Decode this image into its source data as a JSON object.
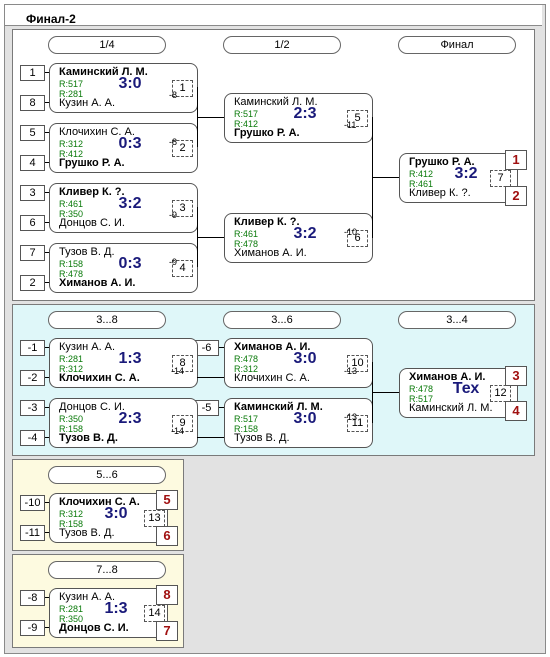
{
  "title": "Финал-2",
  "stages": {
    "q": "1/4",
    "s": "1/2",
    "f": "Финал",
    "r38": "3...8",
    "r36": "3...6",
    "r34": "3...4",
    "r56": "5...6",
    "r78": "7...8"
  },
  "seeds": {
    "s1": "1",
    "s8": "8",
    "s5": "5",
    "s4": "4",
    "s3": "3",
    "s6": "6",
    "s7": "7",
    "s2": "2",
    "m1": "-1",
    "m2": "-2",
    "m3": "-3",
    "m4": "-4",
    "m6": "-6",
    "m5": "-5",
    "m10": "-10",
    "m11": "-11",
    "m8": "-8",
    "m9": "-9"
  },
  "matches": {
    "m1": {
      "p1": "Каминский Л. М.",
      "r1": "R:517",
      "r2": "R:281",
      "p2": "Кузин А. А.",
      "score": "3:0",
      "num": "1",
      "out": "-8"
    },
    "m2": {
      "p1": "Клочихин С. А.",
      "r1": "R:312",
      "r2": "R:412",
      "p2": "Грушко Р. А.",
      "score": "0:3",
      "num": "2",
      "out": "-8"
    },
    "m3": {
      "p1": "Кливер К. ?.",
      "r1": "R:461",
      "r2": "R:350",
      "p2": "Донцов С. И.",
      "score": "3:2",
      "num": "3",
      "out": "-9"
    },
    "m4": {
      "p1": "Тузов В. Д.",
      "r1": "R:158",
      "r2": "R:478",
      "p2": "Химанов А. И.",
      "score": "0:3",
      "num": "4",
      "out": "-9"
    },
    "m5": {
      "p1": "Каминский Л. М.",
      "r1": "R:517",
      "r2": "R:412",
      "p2": "Грушко Р. А.",
      "score": "2:3",
      "num": "5",
      "out": "-11"
    },
    "m6": {
      "p1": "Кливер К. ?.",
      "r1": "R:461",
      "r2": "R:478",
      "p2": "Химанов А. И.",
      "score": "3:2",
      "num": "6",
      "out": "-10"
    },
    "m7": {
      "p1": "Грушко Р. А.",
      "r1": "R:412",
      "r2": "R:461",
      "p2": "Кливер К. ?.",
      "score": "3:2",
      "num": "7",
      "place1": "1",
      "place2": "2"
    },
    "m8": {
      "p1": "Кузин А. А.",
      "r1": "R:281",
      "r2": "R:312",
      "p2": "Клочихин С. А.",
      "score": "1:3",
      "num": "8",
      "out": "-14"
    },
    "m9": {
      "p1": "Донцов С. И.",
      "r1": "R:350",
      "r2": "R:158",
      "p2": "Тузов В. Д.",
      "score": "2:3",
      "num": "9",
      "out": "-14"
    },
    "m10": {
      "p1": "Химанов А. И.",
      "r1": "R:478",
      "r2": "R:312",
      "p2": "Клочихин С. А.",
      "score": "3:0",
      "num": "10",
      "out": "-13"
    },
    "m11": {
      "p1": "Каминский Л. М.",
      "r1": "R:517",
      "r2": "R:158",
      "p2": "Тузов В. Д.",
      "score": "3:0",
      "num": "11",
      "out": "-13"
    },
    "m12": {
      "p1": "Химанов А. И.",
      "r1": "R:478",
      "r2": "R:517",
      "p2": "Каминский Л. М.",
      "score": "Тех",
      "num": "12",
      "place1": "3",
      "place2": "4"
    },
    "m13": {
      "p1": "Клочихин С. А.",
      "r1": "R:312",
      "r2": "R:158",
      "p2": "Тузов В. Д.",
      "score": "3:0",
      "num": "13",
      "place1": "5",
      "place2": "6"
    },
    "m14": {
      "p1": "Кузин А. А.",
      "r1": "R:281",
      "r2": "R:350",
      "p2": "Донцов С. И.",
      "score": "1:3",
      "num": "14",
      "place1": "8",
      "place2": "7"
    }
  },
  "colors": {
    "main_bg": "#ffffff",
    "cons_bg": "#dff7f9",
    "low_bg": "#fdfae0",
    "score": "#1a1a7a",
    "rating": "#0a7a0a",
    "place": "#a01010"
  }
}
